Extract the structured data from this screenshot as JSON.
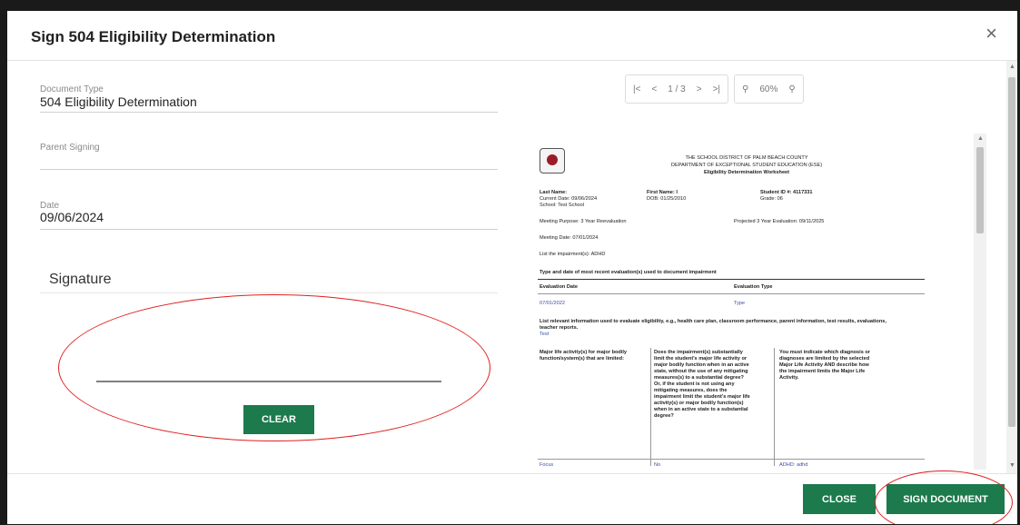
{
  "dialog": {
    "title": "Sign 504 Eligibility Determination",
    "close_icon": "×"
  },
  "form": {
    "document_type_label": "Document Type",
    "document_type_value": "504 Eligibility Determination",
    "parent_signing_label": "Parent Signing",
    "date_label": "Date",
    "date_value": "09/06/2024",
    "signature_heading": "Signature",
    "clear_button": "CLEAR"
  },
  "viewer": {
    "first_page": "|<",
    "prev_page": "<",
    "page_indicator": "1 / 3",
    "next_page": ">",
    "last_page": ">|",
    "zoom_out": "⚲",
    "zoom_level": "60%",
    "zoom_in": "⚲"
  },
  "document": {
    "logo_alt": "district seal",
    "district": "THE SCHOOL DISTRICT OF PALM BEACH COUNTY",
    "department": "DEPARTMENT OF EXCEPTIONAL STUDENT EDUCATION (ESE)",
    "form_title": "Eligibility Determination Worksheet",
    "last_name_label": "Last Name:",
    "current_date_label": "Current Date: 09/06/2024",
    "school_label": "School: Test School",
    "first_name_label": "First Name: I",
    "dob_label": "DOB: 01/25/2010",
    "student_id_label": "Student ID #: 4117331",
    "grade_label": "Grade: 06",
    "meeting_purpose": "Meeting Purpose: 3 Year Reevaluation",
    "projected_eval": "Projected 3 Year Evaluation: 09/11/2025",
    "meeting_date": "Meeting Date: 07/01/2024",
    "impairments": "List the impairment(s): ADHD",
    "type_date_heading": "Type and date of most recent evaluation(s) used to document impairment",
    "col_eval_date": "Evaluation Date",
    "col_eval_type": "Evaluation Type",
    "eval_date_value": "07/01/2022",
    "eval_type_value": "Type",
    "relevant_info": "List relevant information used to evaluate eligibility, e.g., health care plan, classroom performance, parent information, test results, evaluations, teacher reports.",
    "relevant_value": "Test",
    "major_life_col": "Major life activity(s) for major bodily function/system(s) that are limited:",
    "impairment_limit_col": "Does the impairment(s) substantially limit the student's major life activity or major bodily function when in an active state, without the use of any mitigating measures(s) to a substantial degree? Or, if the student is not using any mitigating measures, does the impairment limit the student's major life activity(s) or major bodily function(s) when in an active state to a substantial degree?",
    "indicate_col": "You must indicate which diagnosis or diagnoses are limited by the selected Major Life Activity AND describe how the impairment limits the Major Life Activity.",
    "row_col1": "Focus",
    "row_col2": "No",
    "row_col3": "ADHD: adhd"
  },
  "footer": {
    "close_button": "CLOSE",
    "sign_button": "SIGN DOCUMENT"
  },
  "colors": {
    "accent": "#1c7a4c",
    "annotation": "#e02020"
  }
}
